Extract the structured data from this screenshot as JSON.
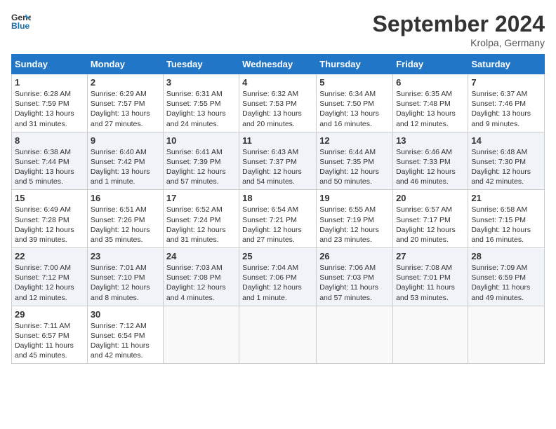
{
  "header": {
    "logo_line1": "General",
    "logo_line2": "Blue",
    "month": "September 2024",
    "location": "Krolpa, Germany"
  },
  "days_of_week": [
    "Sunday",
    "Monday",
    "Tuesday",
    "Wednesday",
    "Thursday",
    "Friday",
    "Saturday"
  ],
  "weeks": [
    [
      {
        "day": "1",
        "sunrise": "6:28 AM",
        "sunset": "7:59 PM",
        "daylight": "13 hours and 31 minutes."
      },
      {
        "day": "2",
        "sunrise": "6:29 AM",
        "sunset": "7:57 PM",
        "daylight": "13 hours and 27 minutes."
      },
      {
        "day": "3",
        "sunrise": "6:31 AM",
        "sunset": "7:55 PM",
        "daylight": "13 hours and 24 minutes."
      },
      {
        "day": "4",
        "sunrise": "6:32 AM",
        "sunset": "7:53 PM",
        "daylight": "13 hours and 20 minutes."
      },
      {
        "day": "5",
        "sunrise": "6:34 AM",
        "sunset": "7:50 PM",
        "daylight": "13 hours and 16 minutes."
      },
      {
        "day": "6",
        "sunrise": "6:35 AM",
        "sunset": "7:48 PM",
        "daylight": "13 hours and 12 minutes."
      },
      {
        "day": "7",
        "sunrise": "6:37 AM",
        "sunset": "7:46 PM",
        "daylight": "13 hours and 9 minutes."
      }
    ],
    [
      {
        "day": "8",
        "sunrise": "6:38 AM",
        "sunset": "7:44 PM",
        "daylight": "13 hours and 5 minutes."
      },
      {
        "day": "9",
        "sunrise": "6:40 AM",
        "sunset": "7:42 PM",
        "daylight": "13 hours and 1 minute."
      },
      {
        "day": "10",
        "sunrise": "6:41 AM",
        "sunset": "7:39 PM",
        "daylight": "12 hours and 57 minutes."
      },
      {
        "day": "11",
        "sunrise": "6:43 AM",
        "sunset": "7:37 PM",
        "daylight": "12 hours and 54 minutes."
      },
      {
        "day": "12",
        "sunrise": "6:44 AM",
        "sunset": "7:35 PM",
        "daylight": "12 hours and 50 minutes."
      },
      {
        "day": "13",
        "sunrise": "6:46 AM",
        "sunset": "7:33 PM",
        "daylight": "12 hours and 46 minutes."
      },
      {
        "day": "14",
        "sunrise": "6:48 AM",
        "sunset": "7:30 PM",
        "daylight": "12 hours and 42 minutes."
      }
    ],
    [
      {
        "day": "15",
        "sunrise": "6:49 AM",
        "sunset": "7:28 PM",
        "daylight": "12 hours and 39 minutes."
      },
      {
        "day": "16",
        "sunrise": "6:51 AM",
        "sunset": "7:26 PM",
        "daylight": "12 hours and 35 minutes."
      },
      {
        "day": "17",
        "sunrise": "6:52 AM",
        "sunset": "7:24 PM",
        "daylight": "12 hours and 31 minutes."
      },
      {
        "day": "18",
        "sunrise": "6:54 AM",
        "sunset": "7:21 PM",
        "daylight": "12 hours and 27 minutes."
      },
      {
        "day": "19",
        "sunrise": "6:55 AM",
        "sunset": "7:19 PM",
        "daylight": "12 hours and 23 minutes."
      },
      {
        "day": "20",
        "sunrise": "6:57 AM",
        "sunset": "7:17 PM",
        "daylight": "12 hours and 20 minutes."
      },
      {
        "day": "21",
        "sunrise": "6:58 AM",
        "sunset": "7:15 PM",
        "daylight": "12 hours and 16 minutes."
      }
    ],
    [
      {
        "day": "22",
        "sunrise": "7:00 AM",
        "sunset": "7:12 PM",
        "daylight": "12 hours and 12 minutes."
      },
      {
        "day": "23",
        "sunrise": "7:01 AM",
        "sunset": "7:10 PM",
        "daylight": "12 hours and 8 minutes."
      },
      {
        "day": "24",
        "sunrise": "7:03 AM",
        "sunset": "7:08 PM",
        "daylight": "12 hours and 4 minutes."
      },
      {
        "day": "25",
        "sunrise": "7:04 AM",
        "sunset": "7:06 PM",
        "daylight": "12 hours and 1 minute."
      },
      {
        "day": "26",
        "sunrise": "7:06 AM",
        "sunset": "7:03 PM",
        "daylight": "11 hours and 57 minutes."
      },
      {
        "day": "27",
        "sunrise": "7:08 AM",
        "sunset": "7:01 PM",
        "daylight": "11 hours and 53 minutes."
      },
      {
        "day": "28",
        "sunrise": "7:09 AM",
        "sunset": "6:59 PM",
        "daylight": "11 hours and 49 minutes."
      }
    ],
    [
      {
        "day": "29",
        "sunrise": "7:11 AM",
        "sunset": "6:57 PM",
        "daylight": "11 hours and 45 minutes."
      },
      {
        "day": "30",
        "sunrise": "7:12 AM",
        "sunset": "6:54 PM",
        "daylight": "11 hours and 42 minutes."
      },
      null,
      null,
      null,
      null,
      null
    ]
  ]
}
